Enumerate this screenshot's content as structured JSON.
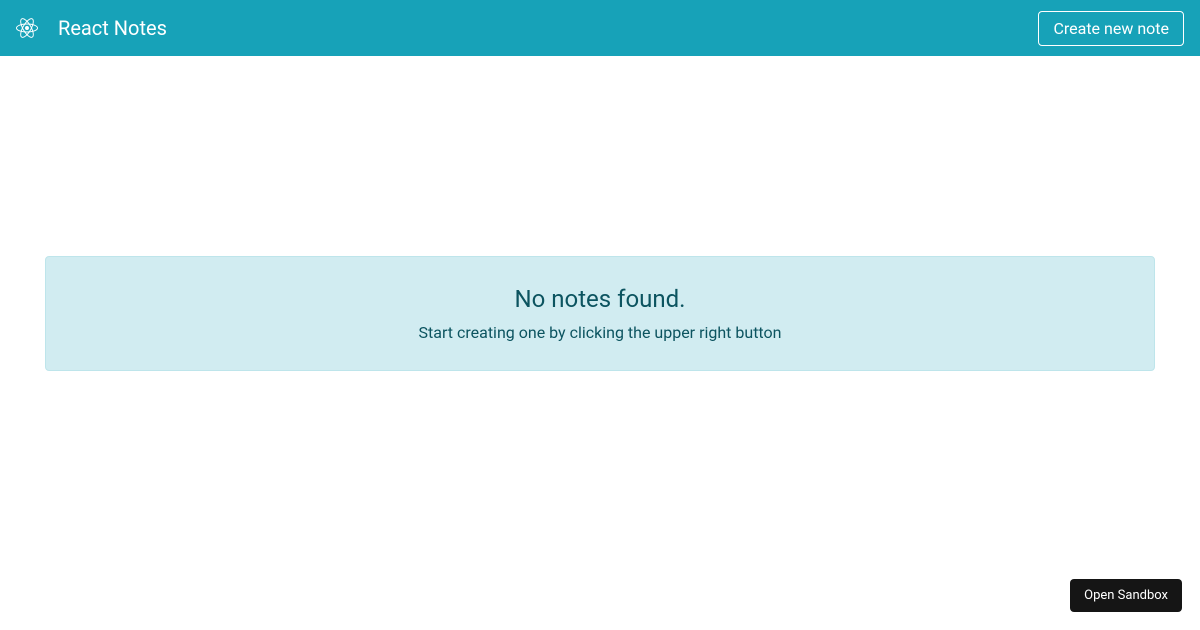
{
  "header": {
    "title": "React Notes",
    "create_button_label": "Create new note"
  },
  "empty_state": {
    "heading": "No notes found.",
    "description": "Start creating one by clicking the upper right button"
  },
  "footer": {
    "sandbox_button_label": "Open Sandbox"
  },
  "colors": {
    "primary": "#17a2b8",
    "alert_bg": "#d1ecf1",
    "alert_border": "#bee5eb",
    "alert_text": "#0c5460",
    "sandbox_bg": "#151515"
  }
}
